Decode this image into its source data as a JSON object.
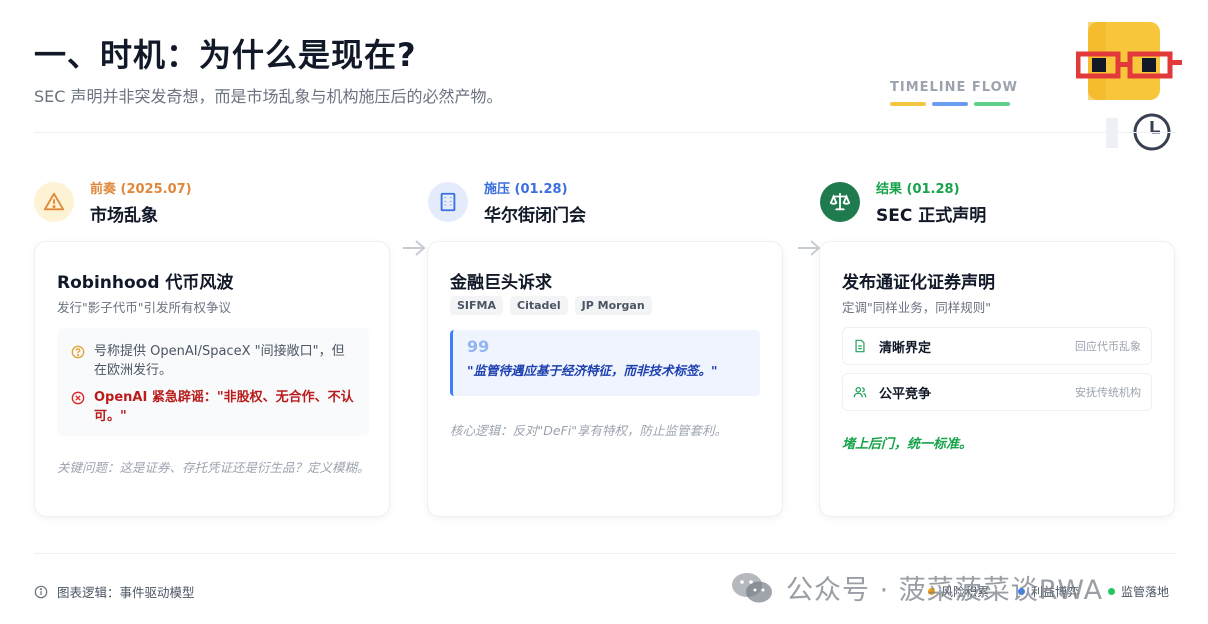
{
  "header": {
    "title": "一、时机：为什么是现在?",
    "subtitle": "SEC 声明并非突发奇想，而是市场乱象与机构施压后的必然产物。",
    "timeline_label": "TIMELINE FLOW",
    "timeline_colors": [
      "#f5c542",
      "#6b9cf2",
      "#5fd08a"
    ]
  },
  "stages": [
    {
      "tag": "前奏 (2025.07)",
      "name": "市场乱象",
      "icon": "warning-triangle-icon",
      "accent": "#e0873a",
      "circle_bg": "#fdf3d4",
      "card": {
        "title": "Robinhood 代币风波",
        "subtitle": "发行\"影子代币\"引发所有权争议",
        "notes": [
          {
            "type": "question",
            "icon": "question-circle-icon",
            "text": "号称提供 OpenAI/SpaceX \"间接敞口\"，但在欧洲发行。"
          },
          {
            "type": "error",
            "icon": "x-circle-icon",
            "text": "OpenAI 紧急辟谣：\"非股权、无合作、不认可。\""
          }
        ],
        "footnote": "关键问题：这是证券、存托凭证还是衍生品？定义模糊。"
      }
    },
    {
      "tag": "施压 (01.28)",
      "name": "华尔街闭门会",
      "icon": "building-icon",
      "accent": "#3b6fe0",
      "circle_bg": "#e4ebfb",
      "card": {
        "title": "金融巨头诉求",
        "chips": [
          "SIFMA",
          "Citadel",
          "JP Morgan"
        ],
        "quote_mark": "99",
        "quote": "\"监管待遇应基于经济特征，而非技术标签。\"",
        "logic": "核心逻辑：反对\"DeFi\"享有特权，防止监管套利。"
      }
    },
    {
      "tag": "结果 (01.28)",
      "name": "SEC 正式声明",
      "icon": "scale-balance-icon",
      "accent": "#16a34a",
      "circle_bg": "#1f7a4d",
      "card": {
        "title": "发布通证化证券声明",
        "subtitle": "定调\"同样业务，同样规则\"",
        "items": [
          {
            "icon": "document-icon",
            "label": "清晰界定",
            "note": "回应代币乱象"
          },
          {
            "icon": "users-icon",
            "label": "公平竞争",
            "note": "安抚传统机构"
          }
        ],
        "slogan": "堵上后门，统一标准。"
      }
    }
  ],
  "footer": {
    "logic_label": "图表逻辑：事件驱动模型",
    "legend": [
      {
        "label": "风险积累",
        "color": "#f59e0b"
      },
      {
        "label": "利益博弈",
        "color": "#3b82f6"
      },
      {
        "label": "监管落地",
        "color": "#22c55e"
      }
    ]
  },
  "watermark": "公众号 · 菠菜菠菜谈RWA"
}
